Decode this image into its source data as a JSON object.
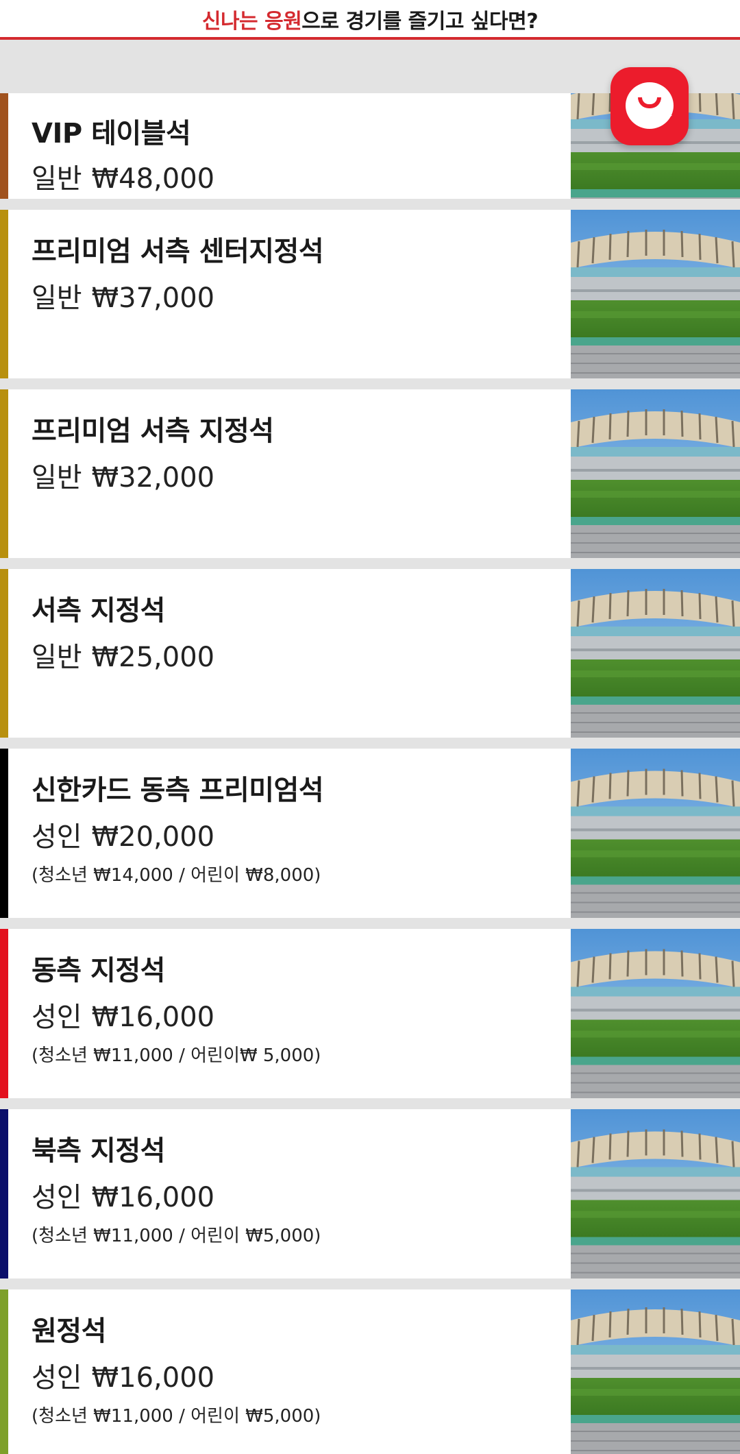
{
  "header": {
    "title_accent": "신나는 응원",
    "title_rest": "으로 경기를 즐기고 싶다면?"
  },
  "chat_button": {
    "icon": "chat-bubble-icon",
    "color": "#ec1c2c"
  },
  "seats": [
    {
      "name": "VIP 테이블석",
      "price_label": "일반",
      "price": "₩48,000",
      "sub": "",
      "color": "#a0521e"
    },
    {
      "name": "프리미엄 서측 센터지정석",
      "price_label": "일반",
      "price": "₩37,000",
      "sub": "",
      "color": "#b8900e"
    },
    {
      "name": "프리미엄 서측 지정석",
      "price_label": "일반",
      "price": "₩32,000",
      "sub": "",
      "color": "#b8900e"
    },
    {
      "name": "서측 지정석",
      "price_label": "일반",
      "price": "₩25,000",
      "sub": "",
      "color": "#b8900e"
    },
    {
      "name": "신한카드 동측 프리미엄석",
      "price_label": "성인",
      "price": "₩20,000",
      "sub": "(청소년 ₩14,000 / 어린이 ₩8,000)",
      "color": "#000000"
    },
    {
      "name": "동측 지정석",
      "price_label": "성인",
      "price": "₩16,000",
      "sub": "(청소년 ₩11,000 / 어린이₩ 5,000)",
      "color": "#e3101e"
    },
    {
      "name": "북측 지정석",
      "price_label": "성인",
      "price": "₩16,000",
      "sub": "(청소년 ₩11,000 / 어린이 ₩5,000)",
      "color": "#0a0e6a"
    },
    {
      "name": "원정석",
      "price_label": "성인",
      "price": "₩16,000",
      "sub": "(청소년 ₩11,000 / 어린이 ₩5,000)",
      "color": "#7ea02a"
    }
  ]
}
